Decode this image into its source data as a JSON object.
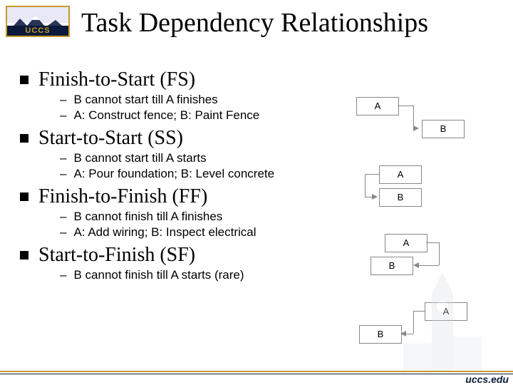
{
  "logo": {
    "text": "UCCS"
  },
  "title": "Task Dependency Relationships",
  "footer_url": "uccs.edu",
  "diagram_labels": {
    "a": "A",
    "b": "B"
  },
  "sections": [
    {
      "heading": "Finish-to-Start (FS)",
      "subs": [
        "B cannot start till A finishes",
        "A: Construct fence; B: Paint Fence"
      ]
    },
    {
      "heading": "Start-to-Start (SS)",
      "subs": [
        "B cannot start till A starts",
        "A: Pour foundation; B: Level concrete"
      ]
    },
    {
      "heading": "Finish-to-Finish (FF)",
      "subs": [
        "B cannot finish till A finishes",
        "A: Add wiring; B: Inspect electrical"
      ]
    },
    {
      "heading": "Start-to-Finish (SF)",
      "subs": [
        "B cannot finish till A starts (rare)"
      ]
    }
  ]
}
